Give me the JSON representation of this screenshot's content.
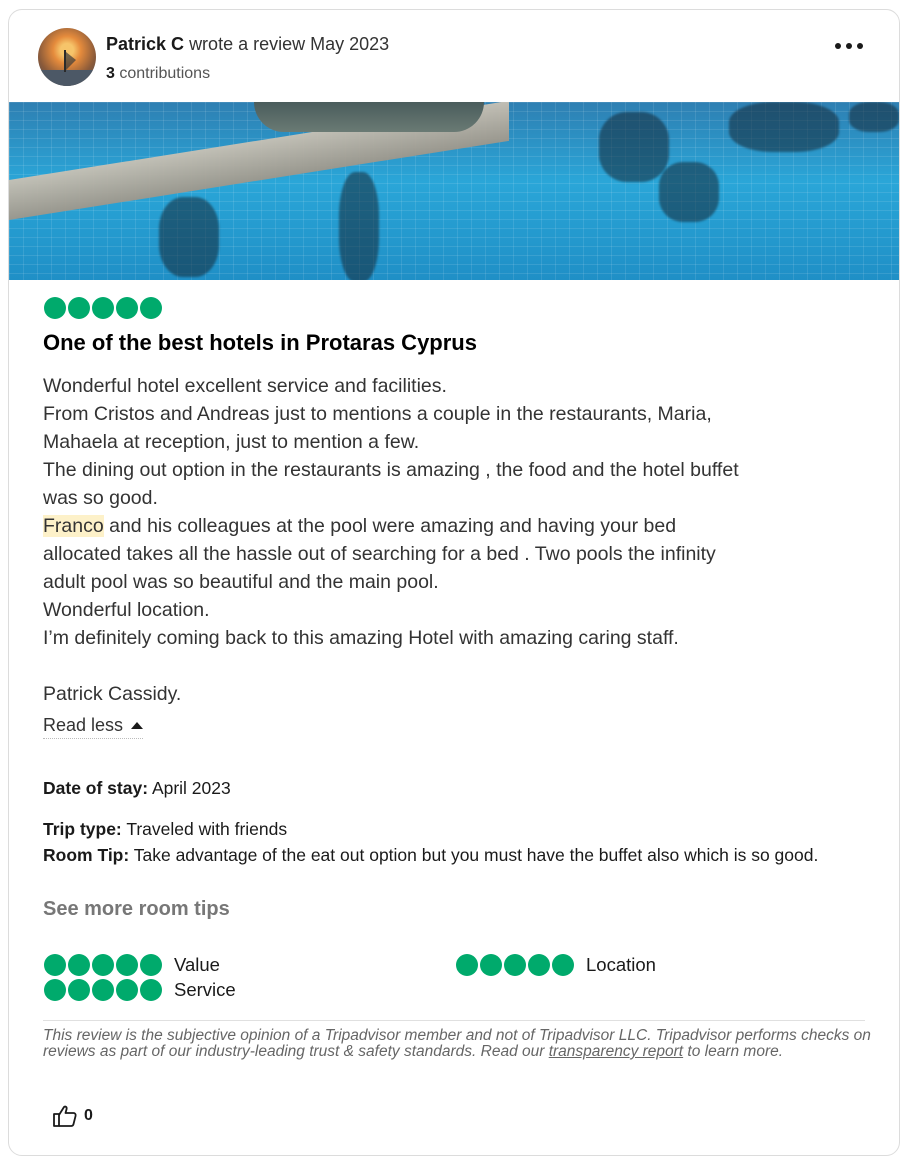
{
  "header": {
    "author": "Patrick C",
    "action": "wrote a review May 2023",
    "contributions_count": "3",
    "contributions_label": "contributions"
  },
  "review": {
    "rating": 5,
    "title": "One of the best hotels in Protaras Cyprus",
    "lines": [
      "Wonderful hotel excellent service and facilities.",
      "From Cristos and Andreas just to mentions a couple in the restaurants, Maria,",
      "Mahaela at reception, just to mention a few.",
      "The dining out option in the restaurants is amazing , the food and the hotel buffet",
      "was so good."
    ],
    "highlight": "Franco",
    "line_after_highlight": " and his colleagues at the pool were amazing and having your bed",
    "lines_2": [
      "allocated takes all the hassle out of searching for a bed . Two pools the infinity",
      "adult pool was so beautiful and the main pool.",
      "Wonderful location.",
      "I’m definitely coming back to this amazing Hotel with amazing caring staff."
    ],
    "signature": "Patrick Cassidy.",
    "read_less": "Read less"
  },
  "details": {
    "date_label": "Date of stay:",
    "date_value": "April 2023",
    "trip_label": "Trip type:",
    "trip_value": "Traveled with friends",
    "tip_label": "Room Tip:",
    "tip_value": "Take advantage of the eat out option but you must have the buffet also which is so good.",
    "see_more": "See more room tips"
  },
  "sub_ratings": [
    {
      "label": "Value",
      "rating": 5
    },
    {
      "label": "Location",
      "rating": 5
    },
    {
      "label": "Service",
      "rating": 5
    }
  ],
  "disclaimer": {
    "text": "This review is the subjective opinion of a Tripadvisor member and not of Tripadvisor LLC. Tripadvisor performs checks on reviews as part of our industry-leading trust & safety standards. Read our ",
    "link": "transparency report",
    "suffix": " to learn more."
  },
  "helpful": {
    "count": "0"
  },
  "colors": {
    "bubble": "#00aa6c",
    "highlight": "#fdf1c9"
  },
  "icons": [
    "more-options-icon",
    "thumbs-up-icon",
    "caret-up-icon"
  ]
}
